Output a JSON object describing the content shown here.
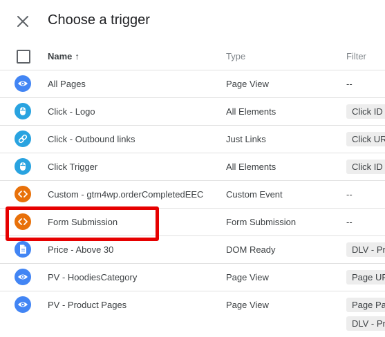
{
  "dialog": {
    "title": "Choose a trigger"
  },
  "columns": {
    "name": "Name",
    "sort_arrow": "↑",
    "type": "Type",
    "filter": "Filter"
  },
  "icon_colors": {
    "blue": "#4285f4",
    "lightblue": "#29a3e0",
    "orange": "#e8710a",
    "highlight": "#e60000"
  },
  "rows": [
    {
      "icon": "eye-icon",
      "color": "#4285f4",
      "name": "All Pages",
      "type": "Page View",
      "filter": "--"
    },
    {
      "icon": "mouse-icon",
      "color": "#29a3e0",
      "name": "Click - Logo",
      "type": "All Elements",
      "filter_chips": [
        "Click ID"
      ]
    },
    {
      "icon": "link-icon",
      "color": "#29a3e0",
      "name": "Click - Outbound links",
      "type": "Just Links",
      "filter_chips": [
        "Click UR"
      ]
    },
    {
      "icon": "mouse-icon",
      "color": "#29a3e0",
      "name": "Click Trigger",
      "type": "All Elements",
      "filter_chips": [
        "Click ID"
      ]
    },
    {
      "icon": "code-icon",
      "color": "#e8710a",
      "name": "Custom - gtm4wp.orderCompletedEEC",
      "type": "Custom Event",
      "filter": "--"
    },
    {
      "icon": "code-icon",
      "color": "#e8710a",
      "name": "Form Submission",
      "type": "Form Submission",
      "filter": "--"
    },
    {
      "icon": "document-icon",
      "color": "#4285f4",
      "name": "Price - Above 30",
      "type": "DOM Ready",
      "filter_chips": [
        "DLV - Pr"
      ]
    },
    {
      "icon": "eye-icon",
      "color": "#4285f4",
      "name": "PV - HoodiesCategory",
      "type": "Page View",
      "filter_chips": [
        "Page UR"
      ]
    },
    {
      "icon": "eye-icon",
      "color": "#4285f4",
      "name": "PV - Product Pages",
      "type": "Page View",
      "filter_chips": [
        "Page Pa",
        "DLV - Pr"
      ]
    }
  ]
}
